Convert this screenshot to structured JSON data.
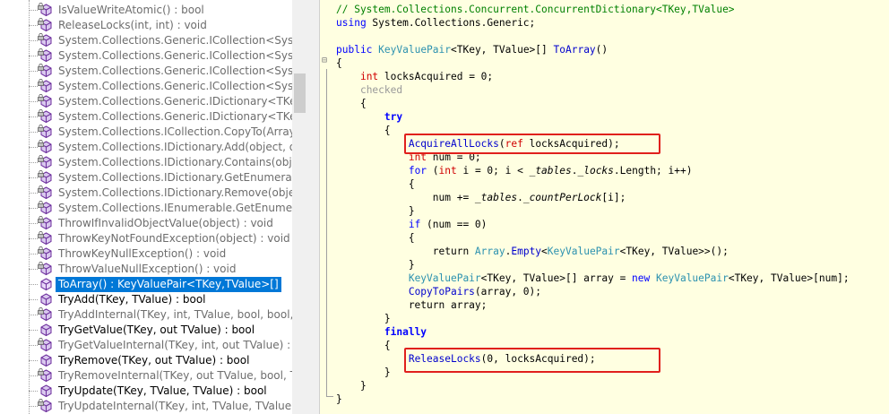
{
  "tree": {
    "items": [
      {
        "label": "IsValueWriteAtomic() : bool",
        "style": "gray"
      },
      {
        "label": "ReleaseLocks(int, int) : void",
        "style": "gray"
      },
      {
        "label": "System.Collections.Generic.ICollection<Syster",
        "style": "gray"
      },
      {
        "label": "System.Collections.Generic.ICollection<Syster",
        "style": "gray"
      },
      {
        "label": "System.Collections.Generic.ICollection<Syster",
        "style": "gray"
      },
      {
        "label": "System.Collections.Generic.ICollection<Syster",
        "style": "gray"
      },
      {
        "label": "System.Collections.Generic.IDictionary<TKey,",
        "style": "gray"
      },
      {
        "label": "System.Collections.Generic.IDictionary<TKey,",
        "style": "gray"
      },
      {
        "label": "System.Collections.ICollection.CopyTo(Array,",
        "style": "gray"
      },
      {
        "label": "System.Collections.IDictionary.Add(object, ob",
        "style": "gray"
      },
      {
        "label": "System.Collections.IDictionary.Contains(objec",
        "style": "gray"
      },
      {
        "label": "System.Collections.IDictionary.GetEnumerato",
        "style": "gray"
      },
      {
        "label": "System.Collections.IDictionary.Remove(object",
        "style": "gray"
      },
      {
        "label": "System.Collections.IEnumerable.GetEnumerat",
        "style": "gray"
      },
      {
        "label": "ThrowIfInvalidObjectValue(object) : void",
        "style": "gray"
      },
      {
        "label": "ThrowKeyNotFoundException(object) : void",
        "style": "gray"
      },
      {
        "label": "ThrowKeyNullException() : void",
        "style": "gray"
      },
      {
        "label": "ThrowValueNullException() : void",
        "style": "gray"
      },
      {
        "label": "ToArray() : KeyValuePair<TKey,TValue>[]",
        "style": "selected"
      },
      {
        "label": "TryAdd(TKey, TValue) : bool",
        "style": "black"
      },
      {
        "label": "TryAddInternal(TKey, int, TValue, bool, bool,",
        "style": "gray"
      },
      {
        "label": "TryGetValue(TKey, out TValue) : bool",
        "style": "black"
      },
      {
        "label": "TryGetValueInternal(TKey, int, out TValue) : b",
        "style": "gray"
      },
      {
        "label": "TryRemove(TKey, out TValue) : bool",
        "style": "black"
      },
      {
        "label": "TryRemoveInternal(TKey, out TValue, bool, T",
        "style": "gray"
      },
      {
        "label": "TryUpdate(TKey, TValue, TValue) : bool",
        "style": "black"
      },
      {
        "label": "TryUpdateInternal(TKey, int, TValue, TValue) :",
        "style": "gray"
      }
    ]
  },
  "code": {
    "lines": [
      [
        {
          "t": "// System.Collections.Concurrent.ConcurrentDictionary<TKey,TValue>",
          "c": "comment"
        }
      ],
      [
        {
          "t": "using",
          "c": "kw"
        },
        {
          "t": " System.Collections.Generic;"
        }
      ],
      [],
      [
        {
          "t": "public",
          "c": "kw"
        },
        {
          "t": " "
        },
        {
          "t": "KeyValuePair",
          "c": "type"
        },
        {
          "t": "<TKey, TValue>[] "
        },
        {
          "t": "ToArray",
          "c": "method"
        },
        {
          "t": "()"
        }
      ],
      [
        {
          "t": "{"
        }
      ],
      [
        {
          "t": "    "
        },
        {
          "t": "int",
          "c": "red"
        },
        {
          "t": " locksAcquired = 0;"
        }
      ],
      [
        {
          "t": "    "
        },
        {
          "t": "checked",
          "c": "gray"
        }
      ],
      [
        {
          "t": "    {"
        }
      ],
      [
        {
          "t": "        "
        },
        {
          "t": "try",
          "c": "kwbold"
        }
      ],
      [
        {
          "t": "        {"
        }
      ],
      [
        {
          "t": "            "
        },
        {
          "t": "AcquireAllLocks",
          "c": "method"
        },
        {
          "t": "("
        },
        {
          "t": "ref",
          "c": "red"
        },
        {
          "t": " locksAcquired);"
        }
      ],
      [
        {
          "t": "            "
        },
        {
          "t": "int",
          "c": "red"
        },
        {
          "t": " num = 0;"
        }
      ],
      [
        {
          "t": "            "
        },
        {
          "t": "for",
          "c": "kw"
        },
        {
          "t": " ("
        },
        {
          "t": "int",
          "c": "red"
        },
        {
          "t": " i = 0; i < "
        },
        {
          "t": "_tables",
          "c": "field"
        },
        {
          "t": "."
        },
        {
          "t": "_locks",
          "c": "field"
        },
        {
          "t": ".Length; i++)"
        }
      ],
      [
        {
          "t": "            {"
        }
      ],
      [
        {
          "t": "                num += "
        },
        {
          "t": "_tables",
          "c": "field"
        },
        {
          "t": "."
        },
        {
          "t": "_countPerLock",
          "c": "field"
        },
        {
          "t": "[i];"
        }
      ],
      [
        {
          "t": "            }"
        }
      ],
      [
        {
          "t": "            "
        },
        {
          "t": "if",
          "c": "kw"
        },
        {
          "t": " (num == 0)"
        }
      ],
      [
        {
          "t": "            {"
        }
      ],
      [
        {
          "t": "                return "
        },
        {
          "t": "Array",
          "c": "type"
        },
        {
          "t": "."
        },
        {
          "t": "Empty",
          "c": "method"
        },
        {
          "t": "<"
        },
        {
          "t": "KeyValuePair",
          "c": "type"
        },
        {
          "t": "<TKey, TValue>>();"
        }
      ],
      [
        {
          "t": "            }"
        }
      ],
      [
        {
          "t": "            "
        },
        {
          "t": "KeyValuePair",
          "c": "type"
        },
        {
          "t": "<TKey, TValue>[] array = "
        },
        {
          "t": "new",
          "c": "kw"
        },
        {
          "t": " "
        },
        {
          "t": "KeyValuePair",
          "c": "type"
        },
        {
          "t": "<TKey, TValue>[num];"
        }
      ],
      [
        {
          "t": "            "
        },
        {
          "t": "CopyToPairs",
          "c": "method"
        },
        {
          "t": "(array, 0);"
        }
      ],
      [
        {
          "t": "            return array;"
        }
      ],
      [
        {
          "t": "        }"
        }
      ],
      [
        {
          "t": "        "
        },
        {
          "t": "finally",
          "c": "kwbold"
        }
      ],
      [
        {
          "t": "        {"
        }
      ],
      [
        {
          "t": "            "
        },
        {
          "t": "ReleaseLocks",
          "c": "method"
        },
        {
          "t": "(0, locksAcquired);"
        }
      ],
      [
        {
          "t": "        }"
        }
      ],
      [
        {
          "t": "    }"
        }
      ],
      [
        {
          "t": "}"
        }
      ]
    ]
  }
}
